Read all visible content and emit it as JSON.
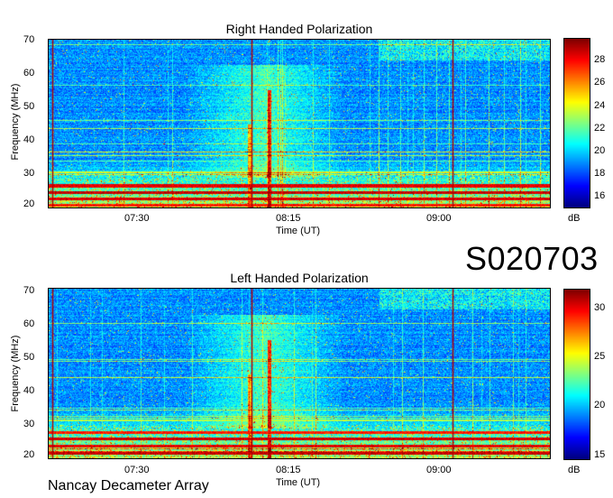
{
  "station_label": "Nancay Decameter Array",
  "observation_id": "S020703",
  "chart_data": [
    {
      "type": "heatmap",
      "title": "Right Handed Polarization",
      "xlabel": "Time (UT)",
      "ylabel": "Frequency (MHz)",
      "x_tick_labels": [
        "07:30",
        "08:15",
        "09:00"
      ],
      "y_ticks": [
        20,
        30,
        40,
        50,
        60,
        70
      ],
      "ylim": [
        20,
        70
      ],
      "colorbar": {
        "label": "dB",
        "ticks": [
          16,
          18,
          20,
          22,
          24,
          26,
          28
        ],
        "range": [
          15,
          30
        ]
      },
      "colormap": "jet"
    },
    {
      "type": "heatmap",
      "title": "Left Handed Polarization",
      "xlabel": "Time (UT)",
      "ylabel": "Frequency (MHz)",
      "x_tick_labels": [
        "07:30",
        "08:15",
        "09:00"
      ],
      "y_ticks": [
        20,
        30,
        40,
        50,
        60,
        70
      ],
      "ylim": [
        20,
        70
      ],
      "colorbar": {
        "label": "dB",
        "ticks": [
          15,
          20,
          25,
          30
        ],
        "range": [
          14.5,
          32
        ]
      },
      "colormap": "jet"
    }
  ]
}
